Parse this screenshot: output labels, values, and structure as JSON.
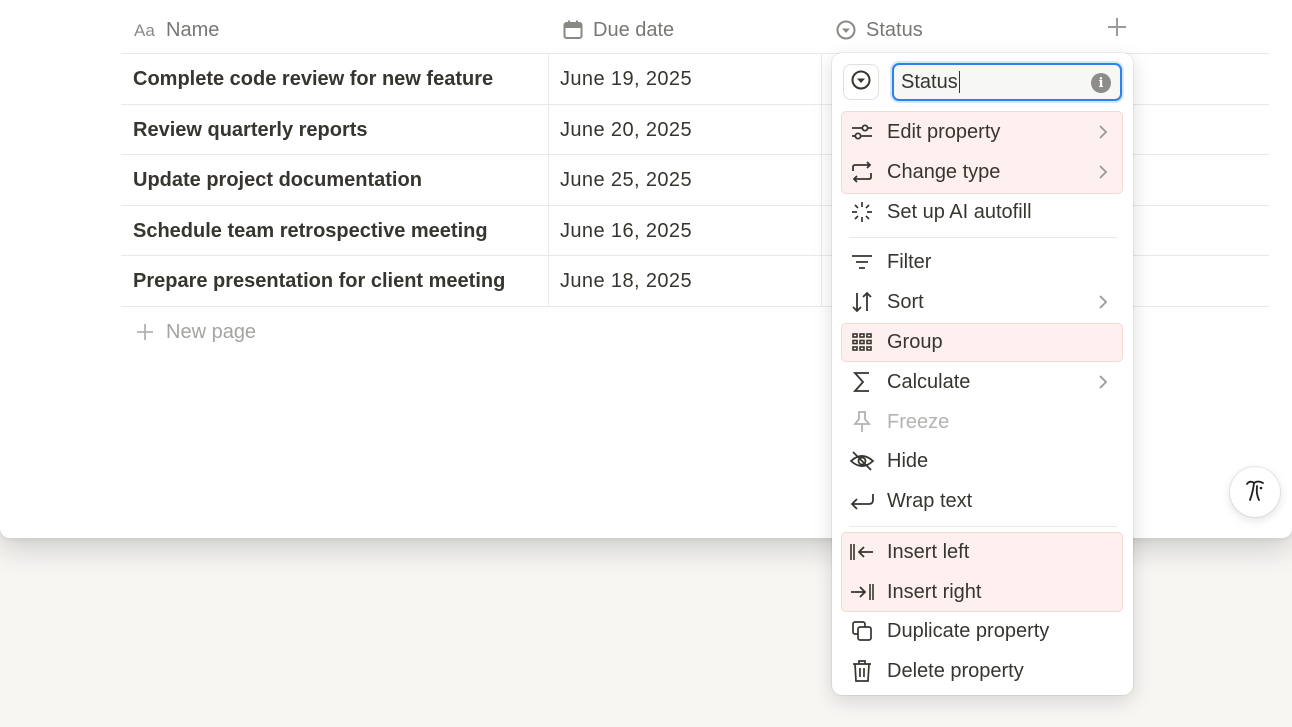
{
  "table": {
    "columns": [
      {
        "label": "Name",
        "icon": "text-type-icon"
      },
      {
        "label": "Due date",
        "icon": "calendar-icon"
      },
      {
        "label": "Status",
        "icon": "status-icon"
      }
    ],
    "rows": [
      {
        "name": "Complete code review for new feature",
        "due": "June 19, 2025"
      },
      {
        "name": "Review quarterly reports",
        "due": "June 20, 2025"
      },
      {
        "name": "Update project documentation",
        "due": "June 25, 2025"
      },
      {
        "name": "Schedule team retrospective meeting",
        "due": "June 16, 2025"
      },
      {
        "name": "Prepare presentation for client meeting",
        "due": "June 18, 2025"
      }
    ],
    "new_page_label": "New page",
    "add_column_icon": "plus-icon"
  },
  "property_menu": {
    "name_value": "Status",
    "info_glyph": "i",
    "items": [
      {
        "label": "Edit property",
        "icon": "sliders-icon",
        "submenu": true
      },
      {
        "label": "Change type",
        "icon": "change-type-icon",
        "submenu": true
      },
      {
        "label": "Set up AI autofill",
        "icon": "sparkle-icon",
        "submenu": false
      },
      {
        "label": "Filter",
        "icon": "filter-icon",
        "submenu": false
      },
      {
        "label": "Sort",
        "icon": "sort-icon",
        "submenu": true
      },
      {
        "label": "Group",
        "icon": "group-icon",
        "submenu": false
      },
      {
        "label": "Calculate",
        "icon": "sigma-icon",
        "submenu": true
      },
      {
        "label": "Freeze",
        "icon": "pin-icon",
        "submenu": false,
        "disabled": true
      },
      {
        "label": "Hide",
        "icon": "eye-off-icon",
        "submenu": false
      },
      {
        "label": "Wrap text",
        "icon": "wrap-icon",
        "submenu": false
      },
      {
        "label": "Insert left",
        "icon": "insert-left-icon",
        "submenu": false
      },
      {
        "label": "Insert right",
        "icon": "insert-right-icon",
        "submenu": false
      },
      {
        "label": "Duplicate property",
        "icon": "duplicate-icon",
        "submenu": false
      },
      {
        "label": "Delete property",
        "icon": "trash-icon",
        "submenu": false
      }
    ]
  },
  "colors": {
    "text": "#37352f",
    "muted": "#787774",
    "focus_ring": "#2f80ed",
    "highlight": "#fdf0ee"
  }
}
